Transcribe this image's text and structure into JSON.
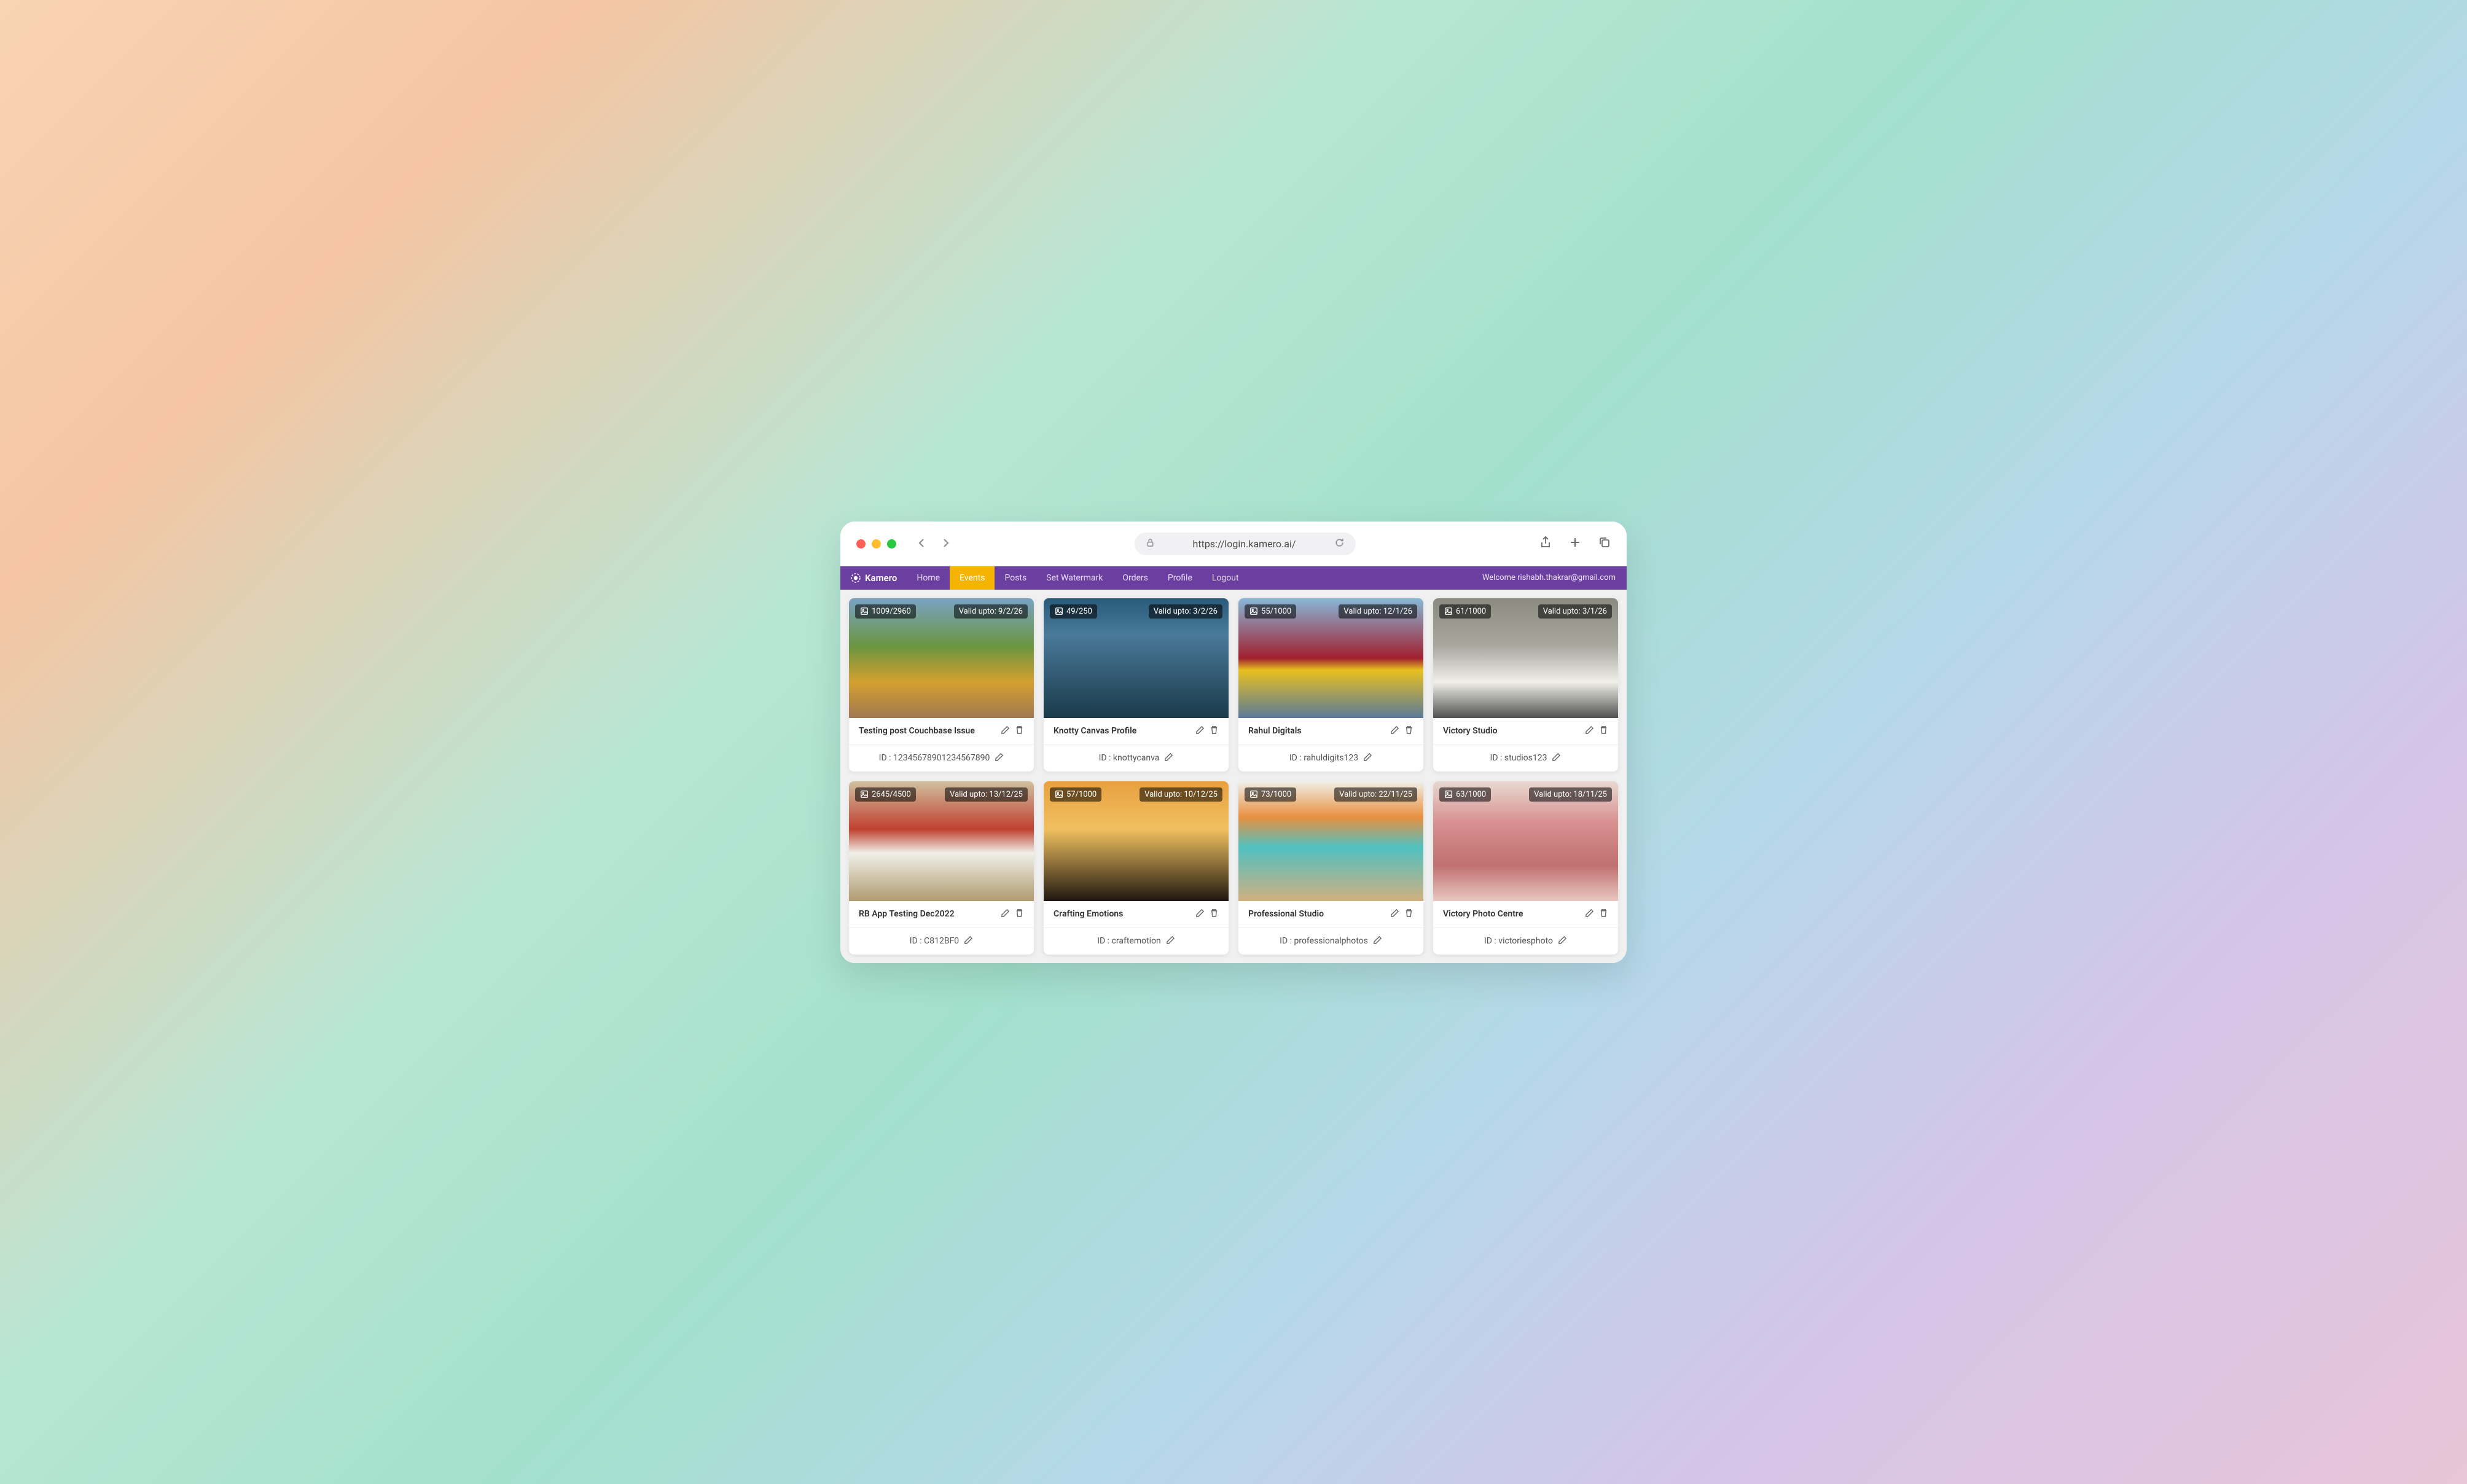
{
  "browser": {
    "url": "https://login.kamero.ai/"
  },
  "header": {
    "brand": "Kamero",
    "nav": {
      "home": "Home",
      "events": "Events",
      "posts": "Posts",
      "watermark": "Set Watermark",
      "orders": "Orders",
      "profile": "Profile",
      "logout": "Logout"
    },
    "welcome": "Welcome rishabh.thakrar@gmail.com"
  },
  "cards": [
    {
      "count": "1009/2960",
      "validity": "Valid upto: 9/2/26",
      "title": "Testing post Couchbase Issue",
      "id_label": "ID : 12345678901234567890"
    },
    {
      "count": "49/250",
      "validity": "Valid upto: 3/2/26",
      "title": "Knotty Canvas Profile",
      "id_label": "ID : knottycanva"
    },
    {
      "count": "55/1000",
      "validity": "Valid upto: 12/1/26",
      "title": "Rahul Digitals",
      "id_label": "ID : rahuldigits123"
    },
    {
      "count": "61/1000",
      "validity": "Valid upto: 3/1/26",
      "title": "Victory Studio",
      "id_label": "ID : studios123"
    },
    {
      "count": "2645/4500",
      "validity": "Valid upto: 13/12/25",
      "title": "RB App Testing Dec2022",
      "id_label": "ID : C812BF0"
    },
    {
      "count": "57/1000",
      "validity": "Valid upto: 10/12/25",
      "title": "Crafting Emotions",
      "id_label": "ID : craftemotion"
    },
    {
      "count": "73/1000",
      "validity": "Valid upto: 22/11/25",
      "title": "Professional Studio",
      "id_label": "ID : professionalphotos"
    },
    {
      "count": "63/1000",
      "validity": "Valid upto: 18/11/25",
      "title": "Victory Photo Centre",
      "id_label": "ID : victoriesphoto"
    }
  ]
}
